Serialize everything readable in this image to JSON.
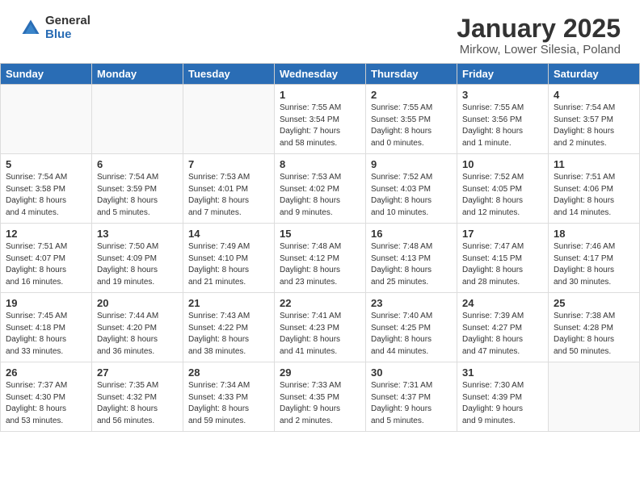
{
  "header": {
    "logo_general": "General",
    "logo_blue": "Blue",
    "title": "January 2025",
    "subtitle": "Mirkow, Lower Silesia, Poland"
  },
  "calendar": {
    "days_of_week": [
      "Sunday",
      "Monday",
      "Tuesday",
      "Wednesday",
      "Thursday",
      "Friday",
      "Saturday"
    ],
    "weeks": [
      [
        {
          "day": "",
          "info": ""
        },
        {
          "day": "",
          "info": ""
        },
        {
          "day": "",
          "info": ""
        },
        {
          "day": "1",
          "info": "Sunrise: 7:55 AM\nSunset: 3:54 PM\nDaylight: 7 hours\nand 58 minutes."
        },
        {
          "day": "2",
          "info": "Sunrise: 7:55 AM\nSunset: 3:55 PM\nDaylight: 8 hours\nand 0 minutes."
        },
        {
          "day": "3",
          "info": "Sunrise: 7:55 AM\nSunset: 3:56 PM\nDaylight: 8 hours\nand 1 minute."
        },
        {
          "day": "4",
          "info": "Sunrise: 7:54 AM\nSunset: 3:57 PM\nDaylight: 8 hours\nand 2 minutes."
        }
      ],
      [
        {
          "day": "5",
          "info": "Sunrise: 7:54 AM\nSunset: 3:58 PM\nDaylight: 8 hours\nand 4 minutes."
        },
        {
          "day": "6",
          "info": "Sunrise: 7:54 AM\nSunset: 3:59 PM\nDaylight: 8 hours\nand 5 minutes."
        },
        {
          "day": "7",
          "info": "Sunrise: 7:53 AM\nSunset: 4:01 PM\nDaylight: 8 hours\nand 7 minutes."
        },
        {
          "day": "8",
          "info": "Sunrise: 7:53 AM\nSunset: 4:02 PM\nDaylight: 8 hours\nand 9 minutes."
        },
        {
          "day": "9",
          "info": "Sunrise: 7:52 AM\nSunset: 4:03 PM\nDaylight: 8 hours\nand 10 minutes."
        },
        {
          "day": "10",
          "info": "Sunrise: 7:52 AM\nSunset: 4:05 PM\nDaylight: 8 hours\nand 12 minutes."
        },
        {
          "day": "11",
          "info": "Sunrise: 7:51 AM\nSunset: 4:06 PM\nDaylight: 8 hours\nand 14 minutes."
        }
      ],
      [
        {
          "day": "12",
          "info": "Sunrise: 7:51 AM\nSunset: 4:07 PM\nDaylight: 8 hours\nand 16 minutes."
        },
        {
          "day": "13",
          "info": "Sunrise: 7:50 AM\nSunset: 4:09 PM\nDaylight: 8 hours\nand 19 minutes."
        },
        {
          "day": "14",
          "info": "Sunrise: 7:49 AM\nSunset: 4:10 PM\nDaylight: 8 hours\nand 21 minutes."
        },
        {
          "day": "15",
          "info": "Sunrise: 7:48 AM\nSunset: 4:12 PM\nDaylight: 8 hours\nand 23 minutes."
        },
        {
          "day": "16",
          "info": "Sunrise: 7:48 AM\nSunset: 4:13 PM\nDaylight: 8 hours\nand 25 minutes."
        },
        {
          "day": "17",
          "info": "Sunrise: 7:47 AM\nSunset: 4:15 PM\nDaylight: 8 hours\nand 28 minutes."
        },
        {
          "day": "18",
          "info": "Sunrise: 7:46 AM\nSunset: 4:17 PM\nDaylight: 8 hours\nand 30 minutes."
        }
      ],
      [
        {
          "day": "19",
          "info": "Sunrise: 7:45 AM\nSunset: 4:18 PM\nDaylight: 8 hours\nand 33 minutes."
        },
        {
          "day": "20",
          "info": "Sunrise: 7:44 AM\nSunset: 4:20 PM\nDaylight: 8 hours\nand 36 minutes."
        },
        {
          "day": "21",
          "info": "Sunrise: 7:43 AM\nSunset: 4:22 PM\nDaylight: 8 hours\nand 38 minutes."
        },
        {
          "day": "22",
          "info": "Sunrise: 7:41 AM\nSunset: 4:23 PM\nDaylight: 8 hours\nand 41 minutes."
        },
        {
          "day": "23",
          "info": "Sunrise: 7:40 AM\nSunset: 4:25 PM\nDaylight: 8 hours\nand 44 minutes."
        },
        {
          "day": "24",
          "info": "Sunrise: 7:39 AM\nSunset: 4:27 PM\nDaylight: 8 hours\nand 47 minutes."
        },
        {
          "day": "25",
          "info": "Sunrise: 7:38 AM\nSunset: 4:28 PM\nDaylight: 8 hours\nand 50 minutes."
        }
      ],
      [
        {
          "day": "26",
          "info": "Sunrise: 7:37 AM\nSunset: 4:30 PM\nDaylight: 8 hours\nand 53 minutes."
        },
        {
          "day": "27",
          "info": "Sunrise: 7:35 AM\nSunset: 4:32 PM\nDaylight: 8 hours\nand 56 minutes."
        },
        {
          "day": "28",
          "info": "Sunrise: 7:34 AM\nSunset: 4:33 PM\nDaylight: 8 hours\nand 59 minutes."
        },
        {
          "day": "29",
          "info": "Sunrise: 7:33 AM\nSunset: 4:35 PM\nDaylight: 9 hours\nand 2 minutes."
        },
        {
          "day": "30",
          "info": "Sunrise: 7:31 AM\nSunset: 4:37 PM\nDaylight: 9 hours\nand 5 minutes."
        },
        {
          "day": "31",
          "info": "Sunrise: 7:30 AM\nSunset: 4:39 PM\nDaylight: 9 hours\nand 9 minutes."
        },
        {
          "day": "",
          "info": ""
        }
      ]
    ]
  }
}
